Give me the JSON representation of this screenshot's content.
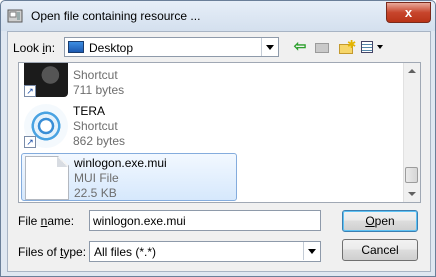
{
  "window": {
    "title": "Open file containing resource ...",
    "close_glyph": "x"
  },
  "toolbar": {
    "look_in_label_pre": "Look ",
    "look_in_label_key": "i",
    "look_in_label_post": "n:",
    "look_in_value": "Desktop",
    "back_icon": "back-arrow-icon",
    "up_icon": "up-folder-icon",
    "new_folder_icon": "new-folder-icon",
    "view_icon": "view-menu-icon"
  },
  "files": [
    {
      "name": "",
      "type": "Shortcut",
      "size": "711 bytes",
      "icon": "steam-shortcut-icon",
      "shortcut": true,
      "selected": false
    },
    {
      "name": "TERA",
      "type": "Shortcut",
      "size": "862 bytes",
      "icon": "tera-icon",
      "shortcut": true,
      "selected": false
    },
    {
      "name": "winlogon.exe.mui",
      "type": "MUI File",
      "size": "22.5 KB",
      "icon": "file-icon",
      "shortcut": false,
      "selected": true
    }
  ],
  "scrollbar": {
    "position": 0.93
  },
  "file_name": {
    "label_pre": "File ",
    "label_key": "n",
    "label_post": "ame:",
    "value": "winlogon.exe.mui"
  },
  "file_type": {
    "label_pre": "Files of ",
    "label_key": "t",
    "label_post": "ype:",
    "value": "All files (*.*)"
  },
  "buttons": {
    "open_key": "O",
    "open_rest": "pen",
    "cancel": "Cancel"
  }
}
